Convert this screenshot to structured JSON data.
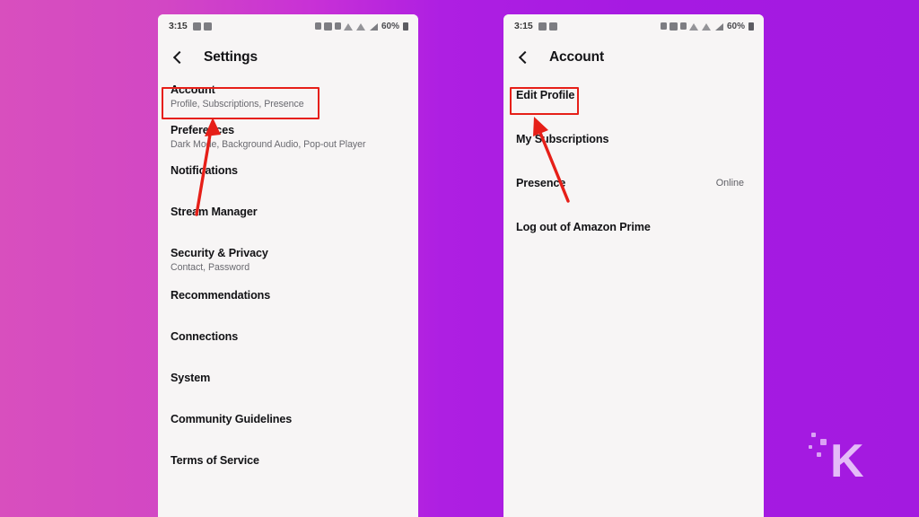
{
  "background": {
    "gradient_from": "#d84fbe",
    "gradient_to": "#a31ae0"
  },
  "annotation": {
    "color": "#e61f18",
    "box_account_label": "Account",
    "box_edit_profile_label": "Edit Profile",
    "arrow_left_name": "arrow-to-account",
    "arrow_right_name": "arrow-to-edit-profile"
  },
  "watermark": {
    "letter": "K",
    "color": "#e2b9f7"
  },
  "status_bar": {
    "time": "3:15",
    "battery_percent": "60%",
    "left_icons": [
      "app-badge-icon",
      "screenshot-icon"
    ],
    "right_icons": [
      "alarm-icon",
      "camera-icon",
      "mute-icon",
      "wifi-icon",
      "signal-weak-icon",
      "signal-icon",
      "battery-icon"
    ]
  },
  "phone_left": {
    "title": "Settings",
    "back_icon": "back-chevron-icon",
    "items": [
      {
        "title": "Account",
        "sub": "Profile, Subscriptions, Presence"
      },
      {
        "title": "Preferences",
        "sub": "Dark Mode, Background Audio, Pop-out Player"
      },
      {
        "title": "Notifications",
        "sub": ""
      },
      {
        "title": "Stream Manager",
        "sub": ""
      },
      {
        "title": "Security & Privacy",
        "sub": "Contact, Password"
      },
      {
        "title": "Recommendations",
        "sub": ""
      },
      {
        "title": "Connections",
        "sub": ""
      },
      {
        "title": "System",
        "sub": ""
      },
      {
        "title": "Community Guidelines",
        "sub": ""
      },
      {
        "title": "Terms of Service",
        "sub": ""
      }
    ]
  },
  "phone_right": {
    "title": "Account",
    "back_icon": "back-chevron-icon",
    "items": [
      {
        "title": "Edit Profile",
        "value": ""
      },
      {
        "title": "My Subscriptions",
        "value": ""
      },
      {
        "title": "Presence",
        "value": "Online"
      },
      {
        "title": "Log out of Amazon Prime",
        "value": ""
      }
    ]
  }
}
